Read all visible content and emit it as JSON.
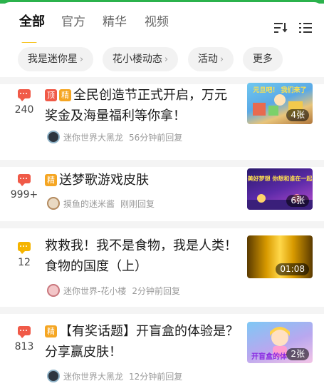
{
  "tabs": [
    {
      "label": "全部",
      "active": true
    },
    {
      "label": "官方",
      "active": false
    },
    {
      "label": "精华",
      "active": false
    },
    {
      "label": "视频",
      "active": false
    }
  ],
  "toolbar": {
    "sort_icon": "sort-icon",
    "filter_icon": "list-filter-icon"
  },
  "chips": [
    {
      "label": "我是迷你星",
      "arrow": "›"
    },
    {
      "label": "花小楼动态",
      "arrow": "›"
    },
    {
      "label": "活动",
      "arrow": "›"
    },
    {
      "label": "更多",
      "arrow": ""
    }
  ],
  "tags": {
    "top": "顶",
    "jing": "精"
  },
  "posts": [
    {
      "reply_count": "240",
      "badge_color": "#f05a48",
      "tags": [
        "top",
        "jing"
      ],
      "title": "全民创造节正式开启，万元奖金及海量福利等你拿！",
      "author": "迷你世界大黑龙",
      "time": "56分钟前回复",
      "media_badge": "4张"
    },
    {
      "reply_count": "999+",
      "badge_color": "#f05a48",
      "tags": [
        "jing"
      ],
      "title": "送梦歌游戏皮肤",
      "author": "摸鱼的迷米酱",
      "time": "刚刚回复",
      "media_badge": "6张"
    },
    {
      "reply_count": "12",
      "badge_color": "#f5b400",
      "tags": [],
      "title": "救救我！我不是食物，我是人类！食物的国度（上）",
      "author": "迷你世界-花小楼",
      "time": "2分钟前回复",
      "media_badge": "01:08"
    },
    {
      "reply_count": "813",
      "badge_color": "#f05a48",
      "tags": [
        "jing"
      ],
      "title": "【有奖话题】开盲盒的体验是？分享赢皮肤！",
      "author": "迷你世界大黑龙",
      "time": "12分钟前回复",
      "media_badge": "2张"
    }
  ],
  "thumb_text": {
    "post1": "元旦吧！ 我们来了",
    "post2": "美好梦想 你想和谁在一起 ",
    "post4": "开盲盒的体"
  },
  "colors": {
    "accent": "#f6c21a",
    "brand_green": "#2bb24c",
    "hot_badge": "#f05a48",
    "warm_badge": "#f5b400"
  }
}
